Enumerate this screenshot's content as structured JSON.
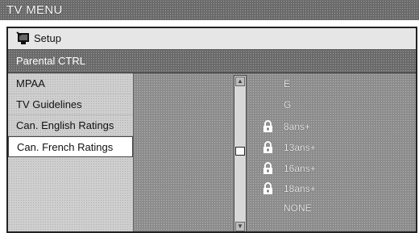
{
  "window": {
    "title": "TV MENU"
  },
  "setup": {
    "label": "Setup",
    "icon": "tv-setup-icon"
  },
  "section": {
    "label": "Parental CTRL"
  },
  "menu": [
    {
      "label": "MPAA",
      "selected": false
    },
    {
      "label": "TV Guidelines",
      "selected": false
    },
    {
      "label": "Can. English Ratings",
      "selected": false
    },
    {
      "label": "Can. French Ratings",
      "selected": true
    }
  ],
  "ratings": [
    {
      "label": "E",
      "locked": false
    },
    {
      "label": "G",
      "locked": false
    },
    {
      "label": "8ans+",
      "locked": true
    },
    {
      "label": "13ans+",
      "locked": true
    },
    {
      "label": "16ans+",
      "locked": true
    },
    {
      "label": "18ans+",
      "locked": true
    },
    {
      "label": "NONE",
      "locked": false
    }
  ],
  "colors": {
    "title_bg": "#6a6a6a",
    "panel_bg": "#8c8c8c",
    "menu_bg": "#cfcfcf",
    "selected_bg": "#ffffff"
  }
}
